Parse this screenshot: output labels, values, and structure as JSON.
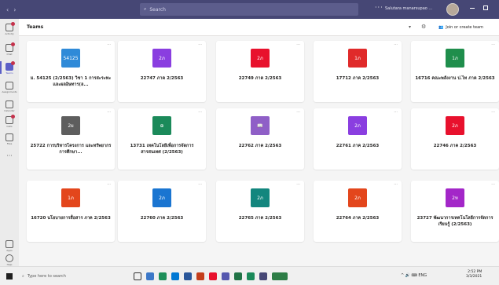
{
  "titlebar": {
    "search_placeholder": "Search",
    "more": "···",
    "user_label": "Salutara manarsupao ..."
  },
  "rail": {
    "items": [
      {
        "label": "Activity",
        "icon": "bell-icon"
      },
      {
        "label": "Chat",
        "icon": "chat-icon"
      },
      {
        "label": "Teams",
        "icon": "teams-icon"
      },
      {
        "label": "Assignments",
        "icon": "assignments-icon"
      },
      {
        "label": "Calendar",
        "icon": "calendar-icon"
      },
      {
        "label": "Calls",
        "icon": "phone-icon"
      },
      {
        "label": "Files",
        "icon": "file-icon"
      }
    ],
    "more": "···",
    "apps_label": "Apps",
    "help_label": "Help"
  },
  "header": {
    "title": "Teams",
    "join_label": "Join or create team"
  },
  "teams": [
    {
      "name": "ม. 54125 (2/2563) วิชา 1 การสะระทะและผลอิษทาร(ล...",
      "initials": "54125",
      "color": "#2f8ad8"
    },
    {
      "name": "22747 ภาค 2/2563",
      "initials": "2ภ",
      "color": "#8a3ee0"
    },
    {
      "name": "22749 ภาค 2/2563",
      "initials": "2ภ",
      "color": "#e8112d"
    },
    {
      "name": "17712 ภาค 2/2563",
      "initials": "1ภ",
      "color": "#e02a2a"
    },
    {
      "name": "16716 คณะพลังงาน ป.ไท ภาค 2/2563",
      "initials": "1ภ",
      "color": "#1f8e4c"
    },
    {
      "name": "25722 การบริหารโครงการ และทรัพยากรการศึกษา...",
      "initials": "2ผ",
      "color": "#5e5e5e"
    },
    {
      "name": "13731 เทคโนโลยีเพื่อการจัดการสารสนเทศ (2/2563)",
      "initials": "⊕",
      "color": "#1b8a5a"
    },
    {
      "name": "22762 ภาค 2/2563",
      "initials": "📖",
      "color": "#8f5fc7"
    },
    {
      "name": "22761 ภาค 2/2563",
      "initials": "2ภ",
      "color": "#8a3ee0"
    },
    {
      "name": "22746 ภาค 2/2563",
      "initials": "2ภ",
      "color": "#e8112d"
    },
    {
      "name": "16720 นโยบายการสื่อสาร ภาค 2/2563",
      "initials": "1ภ",
      "color": "#e3461c"
    },
    {
      "name": "22760 ภาค 2/2563",
      "initials": "2ภ",
      "color": "#1a75d1"
    },
    {
      "name": "22765 ภาค 2/2563",
      "initials": "2ภ",
      "color": "#13867e"
    },
    {
      "name": "22764 ภาค 2/2563",
      "initials": "2ภ",
      "color": "#e3461c"
    },
    {
      "name": "23727 พัฒนาการเทคโนโลยีการจัดการเรียนรู้ (2/2563)",
      "initials": "2ห",
      "color": "#a327c8"
    }
  ],
  "taskbar": {
    "search_placeholder": "Type here to search",
    "tray": "^ 🔊 ⌨ ENG",
    "time": "2:52 PM",
    "date": "3/3/2021"
  }
}
